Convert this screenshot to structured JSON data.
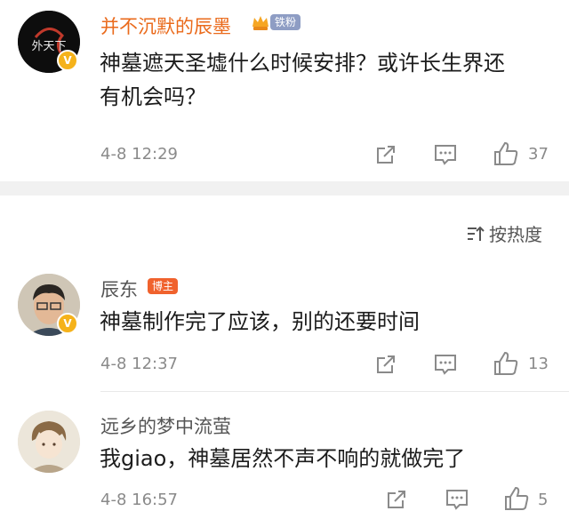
{
  "comments": [
    {
      "username": "并不沉默的辰墨",
      "fan_badge": "铁粉",
      "text_line1": "神墓遮天圣墟什么时候安排？或许长生界还",
      "text_line2": "有机会吗？",
      "time": "4-8 12:29",
      "likes": "37",
      "avatar_text": "外天下",
      "verified_mark": "V"
    },
    {
      "username": "辰东",
      "host_badge": "博主",
      "text": "神墓制作完了应该，别的还要时间",
      "time": "4-8 12:37",
      "likes": "13",
      "verified_mark": "V"
    },
    {
      "username": "远乡的梦中流萤",
      "text": "我giao，神墓居然不声不响的就做完了",
      "time": "4-8 16:57",
      "likes": "5"
    }
  ],
  "sort_label": "按热度",
  "colors": {
    "username_vip": "#ea6a1b",
    "host_badge": "#f0622d",
    "fan_badge": "#8e9dc4",
    "meta_text": "#8a8a8a"
  },
  "icons": [
    "share-icon",
    "comment-icon",
    "like-icon",
    "sort-icon"
  ]
}
